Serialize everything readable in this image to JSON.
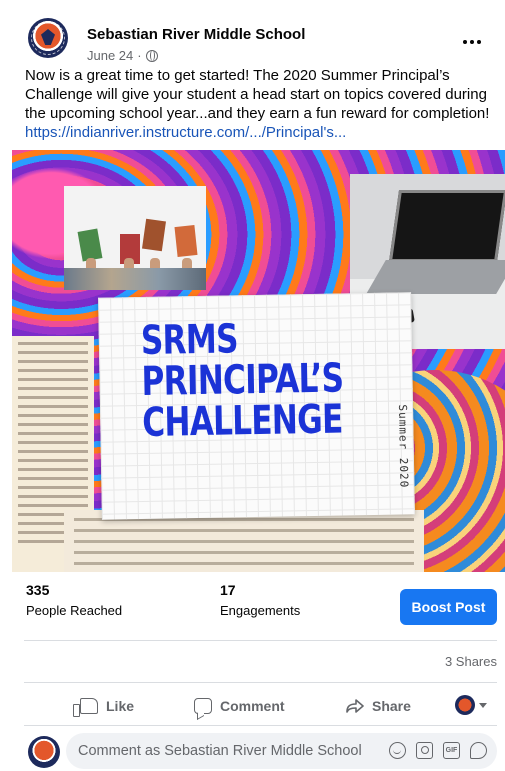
{
  "post": {
    "page_name": "Sebastian River Middle School",
    "date": "June 24",
    "meta_separator": "·",
    "text": "Now is a great time to get started! The 2020 Summer Principal’s Challenge will give your student a head start on topics covered during the upcoming school year...and they earn a fun reward for completion!",
    "link": "https://indianriver.instructure.com/.../Principal's..."
  },
  "image": {
    "headline_line1": "SRMS",
    "headline_line2": "PRINCIPAL’S",
    "headline_line3": "CHALLENGE",
    "side_label": "Summer 2020"
  },
  "stats": {
    "reached_value": "335",
    "reached_label": "People Reached",
    "engagements_value": "17",
    "engagements_label": "Engagements",
    "boost_label": "Boost Post",
    "shares": "3 Shares"
  },
  "actions": {
    "like": "Like",
    "comment": "Comment",
    "share": "Share"
  },
  "comment": {
    "placeholder": "Comment as Sebastian River Middle School"
  },
  "colors": {
    "brand_blue": "#1877f2",
    "link_blue": "#1a55b8",
    "headline_blue": "#1b33d6",
    "secondary_text": "#65676b"
  },
  "icons": [
    "globe-icon",
    "more-icon",
    "like-icon",
    "comment-icon",
    "share-icon",
    "caret-down-icon",
    "emoji-icon",
    "camera-icon",
    "gif-icon",
    "sticker-icon"
  ]
}
